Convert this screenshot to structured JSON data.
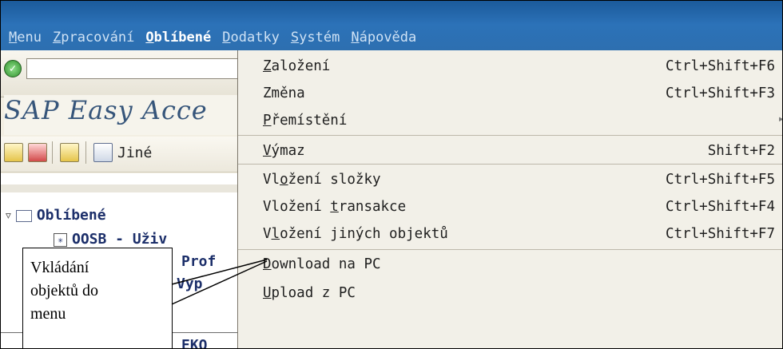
{
  "menubar": {
    "items": [
      {
        "label": "Menu",
        "ul": "M",
        "rest": "enu"
      },
      {
        "label": "Zpracování",
        "ul": "Z",
        "rest": "pracování"
      },
      {
        "label": "Oblíbené",
        "ul": "O",
        "rest": "blíbené"
      },
      {
        "label": "Dodatky",
        "ul": "D",
        "rest": "odatky"
      },
      {
        "label": "Systém",
        "ul": "S",
        "rest": "ystém"
      },
      {
        "label": "Nápověda",
        "ul": "N",
        "rest": "ápověda"
      }
    ]
  },
  "toolbar": {
    "command_value": "",
    "ok_icon": "check-icon"
  },
  "title": "SAP Easy Acce",
  "appbar": {
    "other_label": "Jiné"
  },
  "tree": {
    "root": "Oblíbené",
    "rows": [
      {
        "code": "OOSB - Uživ"
      },
      {
        "code": "Prof"
      },
      {
        "code": "Vyp"
      },
      {
        "code": "EKO"
      }
    ]
  },
  "dropdown": {
    "items": [
      {
        "pre": "",
        "ul": "Z",
        "post": "aložení",
        "shortcut": "Ctrl+Shift+F6"
      },
      {
        "pre": "Změna",
        "ul": "",
        "post": "",
        "shortcut": "Ctrl+Shift+F3"
      },
      {
        "pre": "",
        "ul": "P",
        "post": "řemístění",
        "shortcut": "",
        "submenu": true
      },
      {
        "pre": "",
        "ul": "V",
        "post": "ýmaz",
        "shortcut": "Shift+F2"
      },
      {
        "pre": "Vl",
        "ul": "o",
        "post": "žení složky",
        "shortcut": "Ctrl+Shift+F5"
      },
      {
        "pre": "Vložení ",
        "ul": "t",
        "post": "ransakce",
        "shortcut": "Ctrl+Shift+F4"
      },
      {
        "pre": "V",
        "ul": "l",
        "post": "ožení jiných objektů",
        "shortcut": "Ctrl+Shift+F7"
      },
      {
        "pre": "",
        "ul": "D",
        "post": "ownload na PC",
        "shortcut": ""
      },
      {
        "pre": "",
        "ul": "U",
        "post": "pload z PC",
        "shortcut": ""
      }
    ]
  },
  "callout": {
    "lines": [
      "Vkládání",
      "objektů do",
      "menu"
    ]
  },
  "colors": {
    "menubar": "#2c72b8",
    "title": "#36557a",
    "menu_bg": "#f2f0e8"
  }
}
